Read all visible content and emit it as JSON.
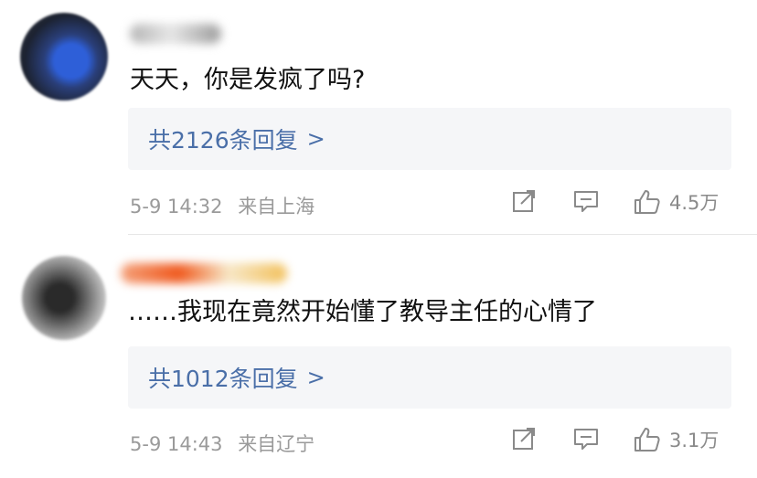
{
  "comments": [
    {
      "text": "天天，你是发疯了吗?",
      "replies_label": "共2126条回复",
      "chevron": ">",
      "date": "5-9 14:32",
      "location": "来自上海",
      "like_count": "4.5万",
      "icons": [
        "share-icon",
        "comment-icon",
        "like-icon"
      ]
    },
    {
      "text": "……我现在竟然开始懂了教导主任的心情了",
      "replies_label": "共1012条回复",
      "chevron": ">",
      "date": "5-9 14:43",
      "location": "来自辽宁",
      "like_count": "3.1万",
      "icons": [
        "share-icon",
        "comment-icon",
        "like-icon"
      ]
    }
  ],
  "colors": {
    "reply_link": "#4a6fa8",
    "meta_text": "#9a9a9a",
    "reply_box_bg": "#f5f6f8"
  }
}
